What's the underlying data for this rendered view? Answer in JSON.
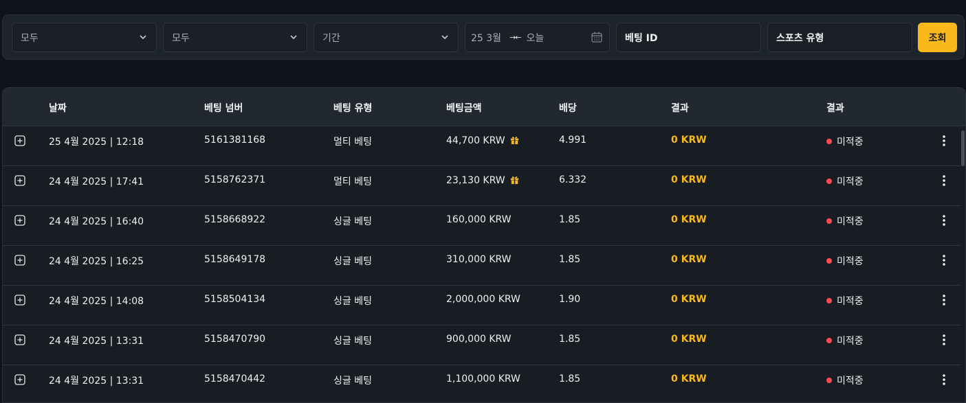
{
  "filters": {
    "select1": "모두",
    "select2": "모두",
    "period": "기간",
    "date_from": "25 3월",
    "date_to": "오늘",
    "bet_id": "베팅 ID",
    "sport_type": "스포츠 유형",
    "search_button": "조회"
  },
  "columns": {
    "date": "날짜",
    "bet_number": "베팅 넘버",
    "bet_type": "베팅 유형",
    "amount": "베팅금액",
    "odds": "배당",
    "result": "결과",
    "status": "결과"
  },
  "rows": [
    {
      "date": "25 4월 2025 | 12:18",
      "number": "5161381168",
      "type": "멀티 베팅",
      "amount": "44,700 KRW",
      "gift": true,
      "odds": "4.991",
      "result": "0 KRW",
      "status": "미적중"
    },
    {
      "date": "24 4월 2025 | 17:41",
      "number": "5158762371",
      "type": "멀티 베팅",
      "amount": "23,130 KRW",
      "gift": true,
      "odds": "6.332",
      "result": "0 KRW",
      "status": "미적중"
    },
    {
      "date": "24 4월 2025 | 16:40",
      "number": "5158668922",
      "type": "싱글 베팅",
      "amount": "160,000 KRW",
      "gift": false,
      "odds": "1.85",
      "result": "0 KRW",
      "status": "미적중"
    },
    {
      "date": "24 4월 2025 | 16:25",
      "number": "5158649178",
      "type": "싱글 베팅",
      "amount": "310,000 KRW",
      "gift": false,
      "odds": "1.85",
      "result": "0 KRW",
      "status": "미적중"
    },
    {
      "date": "24 4월 2025 | 14:08",
      "number": "5158504134",
      "type": "싱글 베팅",
      "amount": "2,000,000 KRW",
      "gift": false,
      "odds": "1.90",
      "result": "0 KRW",
      "status": "미적중"
    },
    {
      "date": "24 4월 2025 | 13:31",
      "number": "5158470790",
      "type": "싱글 베팅",
      "amount": "900,000 KRW",
      "gift": false,
      "odds": "1.85",
      "result": "0 KRW",
      "status": "미적중"
    },
    {
      "date": "24 4월 2025 | 13:31",
      "number": "5158470442",
      "type": "싱글 베팅",
      "amount": "1,100,000 KRW",
      "gift": false,
      "odds": "1.85",
      "result": "0 KRW",
      "status": "미적중"
    }
  ],
  "icons": {
    "expand": "plus-square-icon",
    "gift": "gift-icon",
    "more": "kebab-menu-icon",
    "calendar": "calendar-icon",
    "swap": "arrows-inward-icon",
    "chevron": "chevron-down-icon"
  },
  "colors": {
    "accent": "#f9b91b",
    "lost_dot": "#ff4d4f",
    "background": "#0f141a"
  }
}
